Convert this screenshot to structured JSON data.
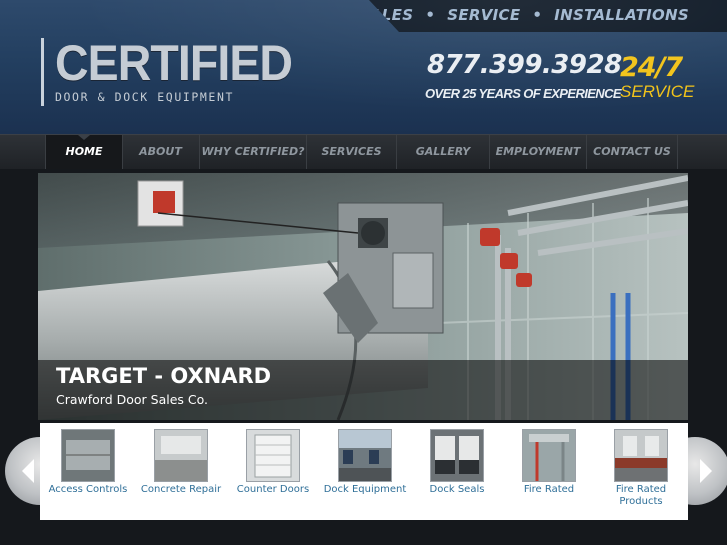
{
  "topbar": {
    "links": [
      "SALES",
      "SERVICE",
      "INSTALLATIONS"
    ],
    "separator": "•"
  },
  "logo": {
    "name": "CERTIFIED",
    "tagline": "DOOR & DOCK EQUIPMENT"
  },
  "contact": {
    "phone": "877.399.3928",
    "experience": "OVER 25 YEARS OF EXPERIENCE",
    "hours": "24/7",
    "service": "SERVICE"
  },
  "nav": {
    "items": [
      "HOME",
      "ABOUT",
      "WHY CERTIFIED?",
      "SERVICES",
      "GALLERY",
      "EMPLOYMENT",
      "CONTACT US"
    ],
    "active": "HOME"
  },
  "hero": {
    "title": "TARGET - OXNARD",
    "subtitle": "Crawford Door Sales Co."
  },
  "carousel": {
    "items": [
      {
        "label": "Access Controls",
        "icon": "access-controls-thumb"
      },
      {
        "label": "Concrete Repair",
        "icon": "concrete-repair-thumb"
      },
      {
        "label": "Counter Doors",
        "icon": "counter-doors-thumb"
      },
      {
        "label": "Dock Equipment",
        "icon": "dock-equipment-thumb"
      },
      {
        "label": "Dock Seals",
        "icon": "dock-seals-thumb"
      },
      {
        "label": "Fire Rated",
        "icon": "fire-rated-thumb"
      },
      {
        "label": "Fire Rated Products",
        "icon": "fire-rated-products-thumb"
      }
    ]
  },
  "colors": {
    "accent": "#f2c318",
    "link": "#2f6f98",
    "header": "#233f60"
  }
}
